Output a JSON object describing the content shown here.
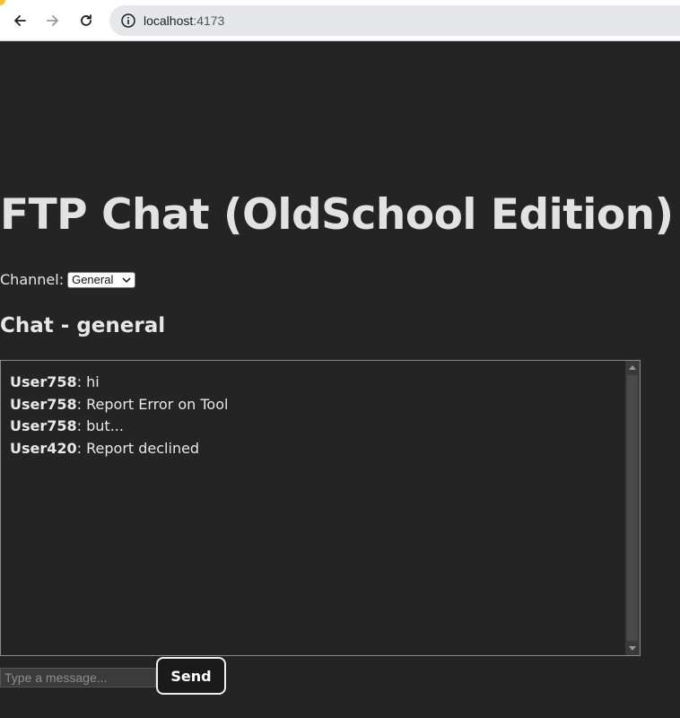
{
  "browser": {
    "url_host": "localhost",
    "url_port": ":4173"
  },
  "app": {
    "title": "FTP Chat (OldSchool Edition)",
    "channel_label": "Channel:",
    "channel_selected": "General",
    "chat_heading": "Chat - general",
    "messages": [
      {
        "user": "User758",
        "text": ": hi"
      },
      {
        "user": "User758",
        "text": ": Report Error on Tool"
      },
      {
        "user": "User758",
        "text": ": but..."
      },
      {
        "user": "User420",
        "text": ": Report declined"
      }
    ],
    "input_placeholder": "Type a message...",
    "send_label": "Send"
  },
  "colors": {
    "background": "#242424",
    "text": "#e8e8e8",
    "button_bg": "#1a1a1a",
    "button_border": "#f0f0f0"
  }
}
